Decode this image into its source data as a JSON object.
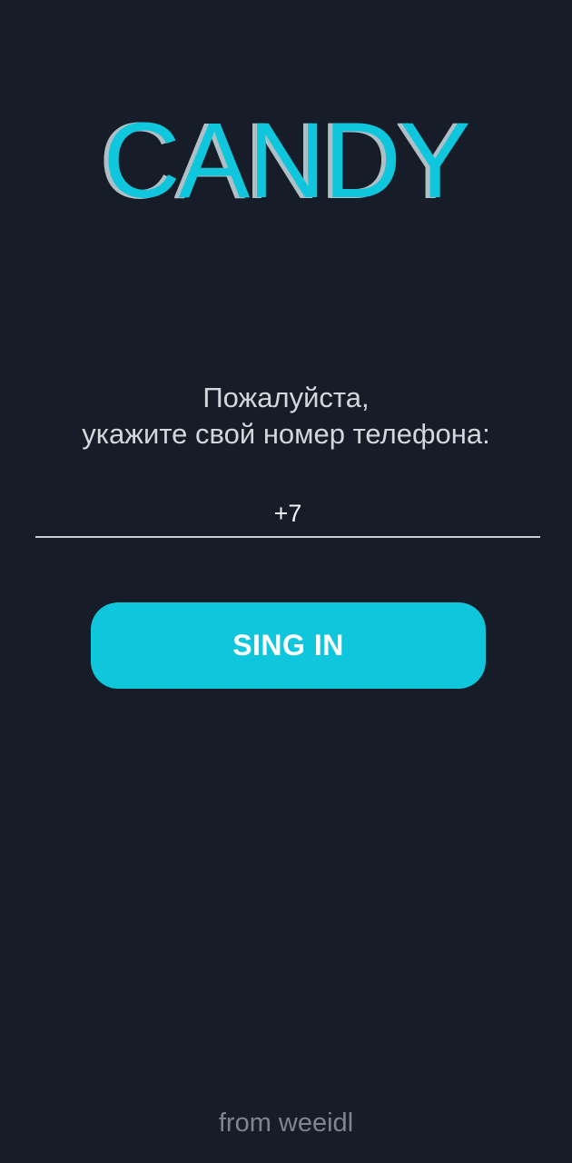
{
  "logo": {
    "text": "CANDY",
    "color": "#10c6dd",
    "shadow_color": "#aebfc6"
  },
  "prompt": {
    "line1": "Пожалуйста,",
    "line2": "укажите свой номер телефона:"
  },
  "phone_input": {
    "value": "+7",
    "placeholder": ""
  },
  "signin_button": {
    "label": "SING IN",
    "color": "#10c6dd"
  },
  "footer": {
    "text": "from weeidl"
  },
  "theme": {
    "background": "#171d28",
    "text": "#d3d6da"
  }
}
